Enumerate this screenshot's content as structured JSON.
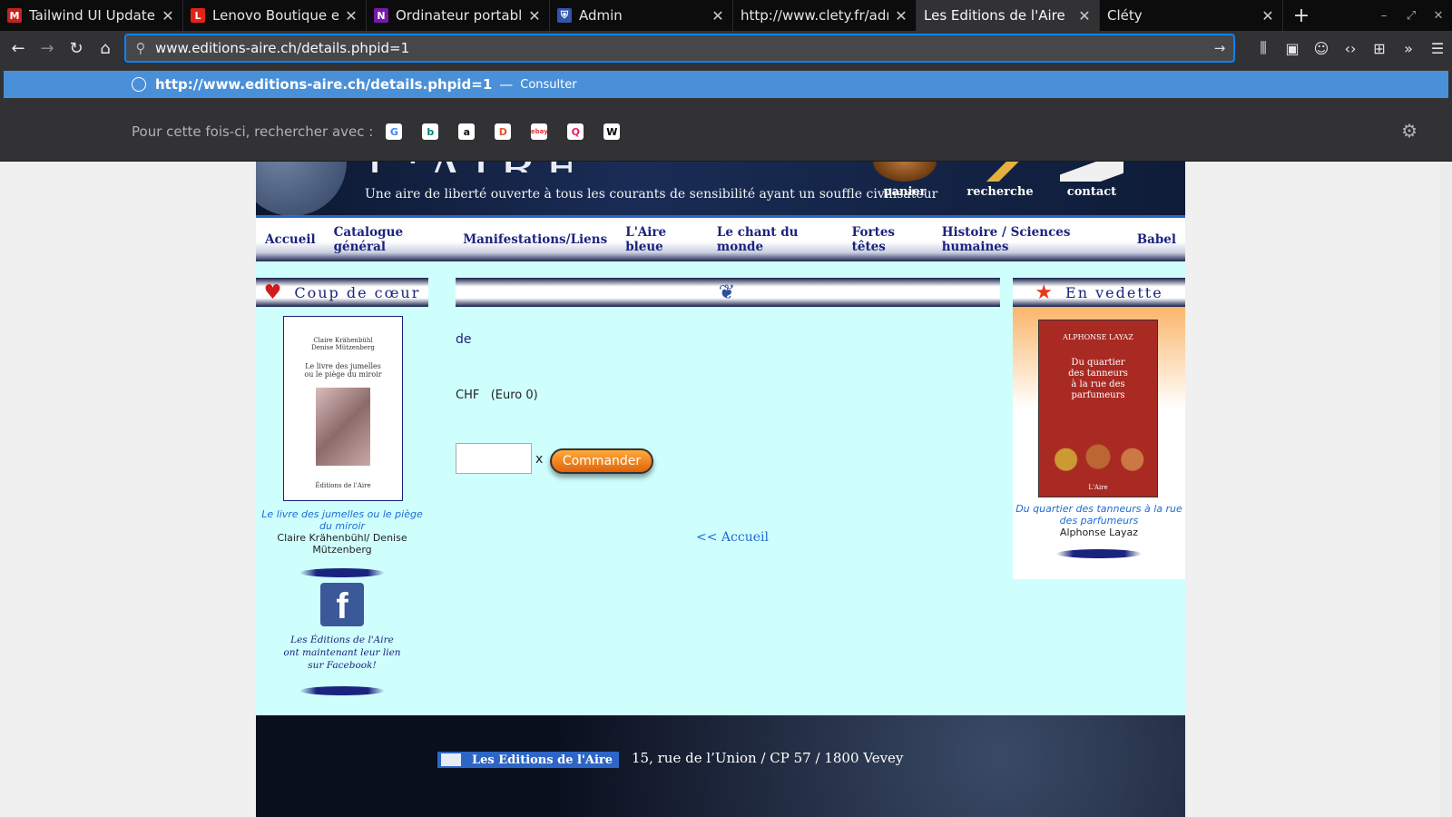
{
  "tabs": [
    {
      "label": "Tailwind UI Update: A",
      "icon": "gmail-icon",
      "color": "#c5221f",
      "glyph": "M"
    },
    {
      "label": "Lenovo Boutique en li",
      "icon": "lenovo-icon",
      "color": "#e2231a",
      "glyph": "L"
    },
    {
      "label": "Ordinateur portable d",
      "icon": "onenote-icon",
      "color": "#7719aa",
      "glyph": "N"
    },
    {
      "label": "Admin",
      "icon": "shield-icon",
      "color": "#3355aa",
      "glyph": "⛨"
    },
    {
      "label": "http://www.clety.fr/adm",
      "icon": "",
      "color": "",
      "glyph": ""
    },
    {
      "label": "Les Editions de l'Aire",
      "icon": "",
      "color": "",
      "glyph": ""
    },
    {
      "label": "Cléty",
      "icon": "",
      "color": "",
      "glyph": ""
    }
  ],
  "url": "www.editions-aire.ch/details.phpid=1",
  "suggestion": {
    "url": "http://www.editions-aire.ch/details.phpid=1",
    "action": "Consulter"
  },
  "oneoff_label": "Pour cette fois-ci, rechercher avec :",
  "banner": {
    "tagline": "Une aire de liberté ouverte à tous les courants de sensibilité ayant un souffle civilisateur",
    "panier": "panier",
    "recherche": "recherche",
    "contact": "contact"
  },
  "menu": [
    "Accueil",
    "Catalogue général",
    "Manifestations/Liens",
    "L'Aire bleue",
    "Le chant du monde",
    "Fortes têtes",
    "Histoire / Sciences humaines",
    "Babel"
  ],
  "left": {
    "heading": "Coup de cœur",
    "book_title": "Le livre des jumelles ou le piège du miroir",
    "book_author": "Claire Krähenbühl/ Denise Mützenberg",
    "cover_authors": "Claire Krähenbühl\nDenise Mützenberg",
    "cover_title": "Le livre des jumelles\nou le piège du miroir",
    "cover_publisher": "Éditions de l'Aire",
    "fb_text": "Les Éditions de l'Aire\nont maintenant leur lien\nsur Facebook!"
  },
  "center": {
    "de": "de",
    "price": "CHF   (Euro 0)",
    "qty_x": "x",
    "order": "Commander",
    "home": "<< Accueil"
  },
  "right": {
    "heading": "En vedette",
    "book_title": "Du quartier des tanneurs à la rue des parfumeurs",
    "book_author": "Alphonse Layaz",
    "cover_author": "Alphonse Layaz",
    "cover_title": "Du quartier\ndes tanneurs\nà la rue des\nparfumeurs",
    "cover_publisher": "L'Aire"
  },
  "footer": {
    "logo": "Les Editions de l'Aire",
    "address": "15, rue de l’Union / CP 57 / 1800 Vevey"
  }
}
